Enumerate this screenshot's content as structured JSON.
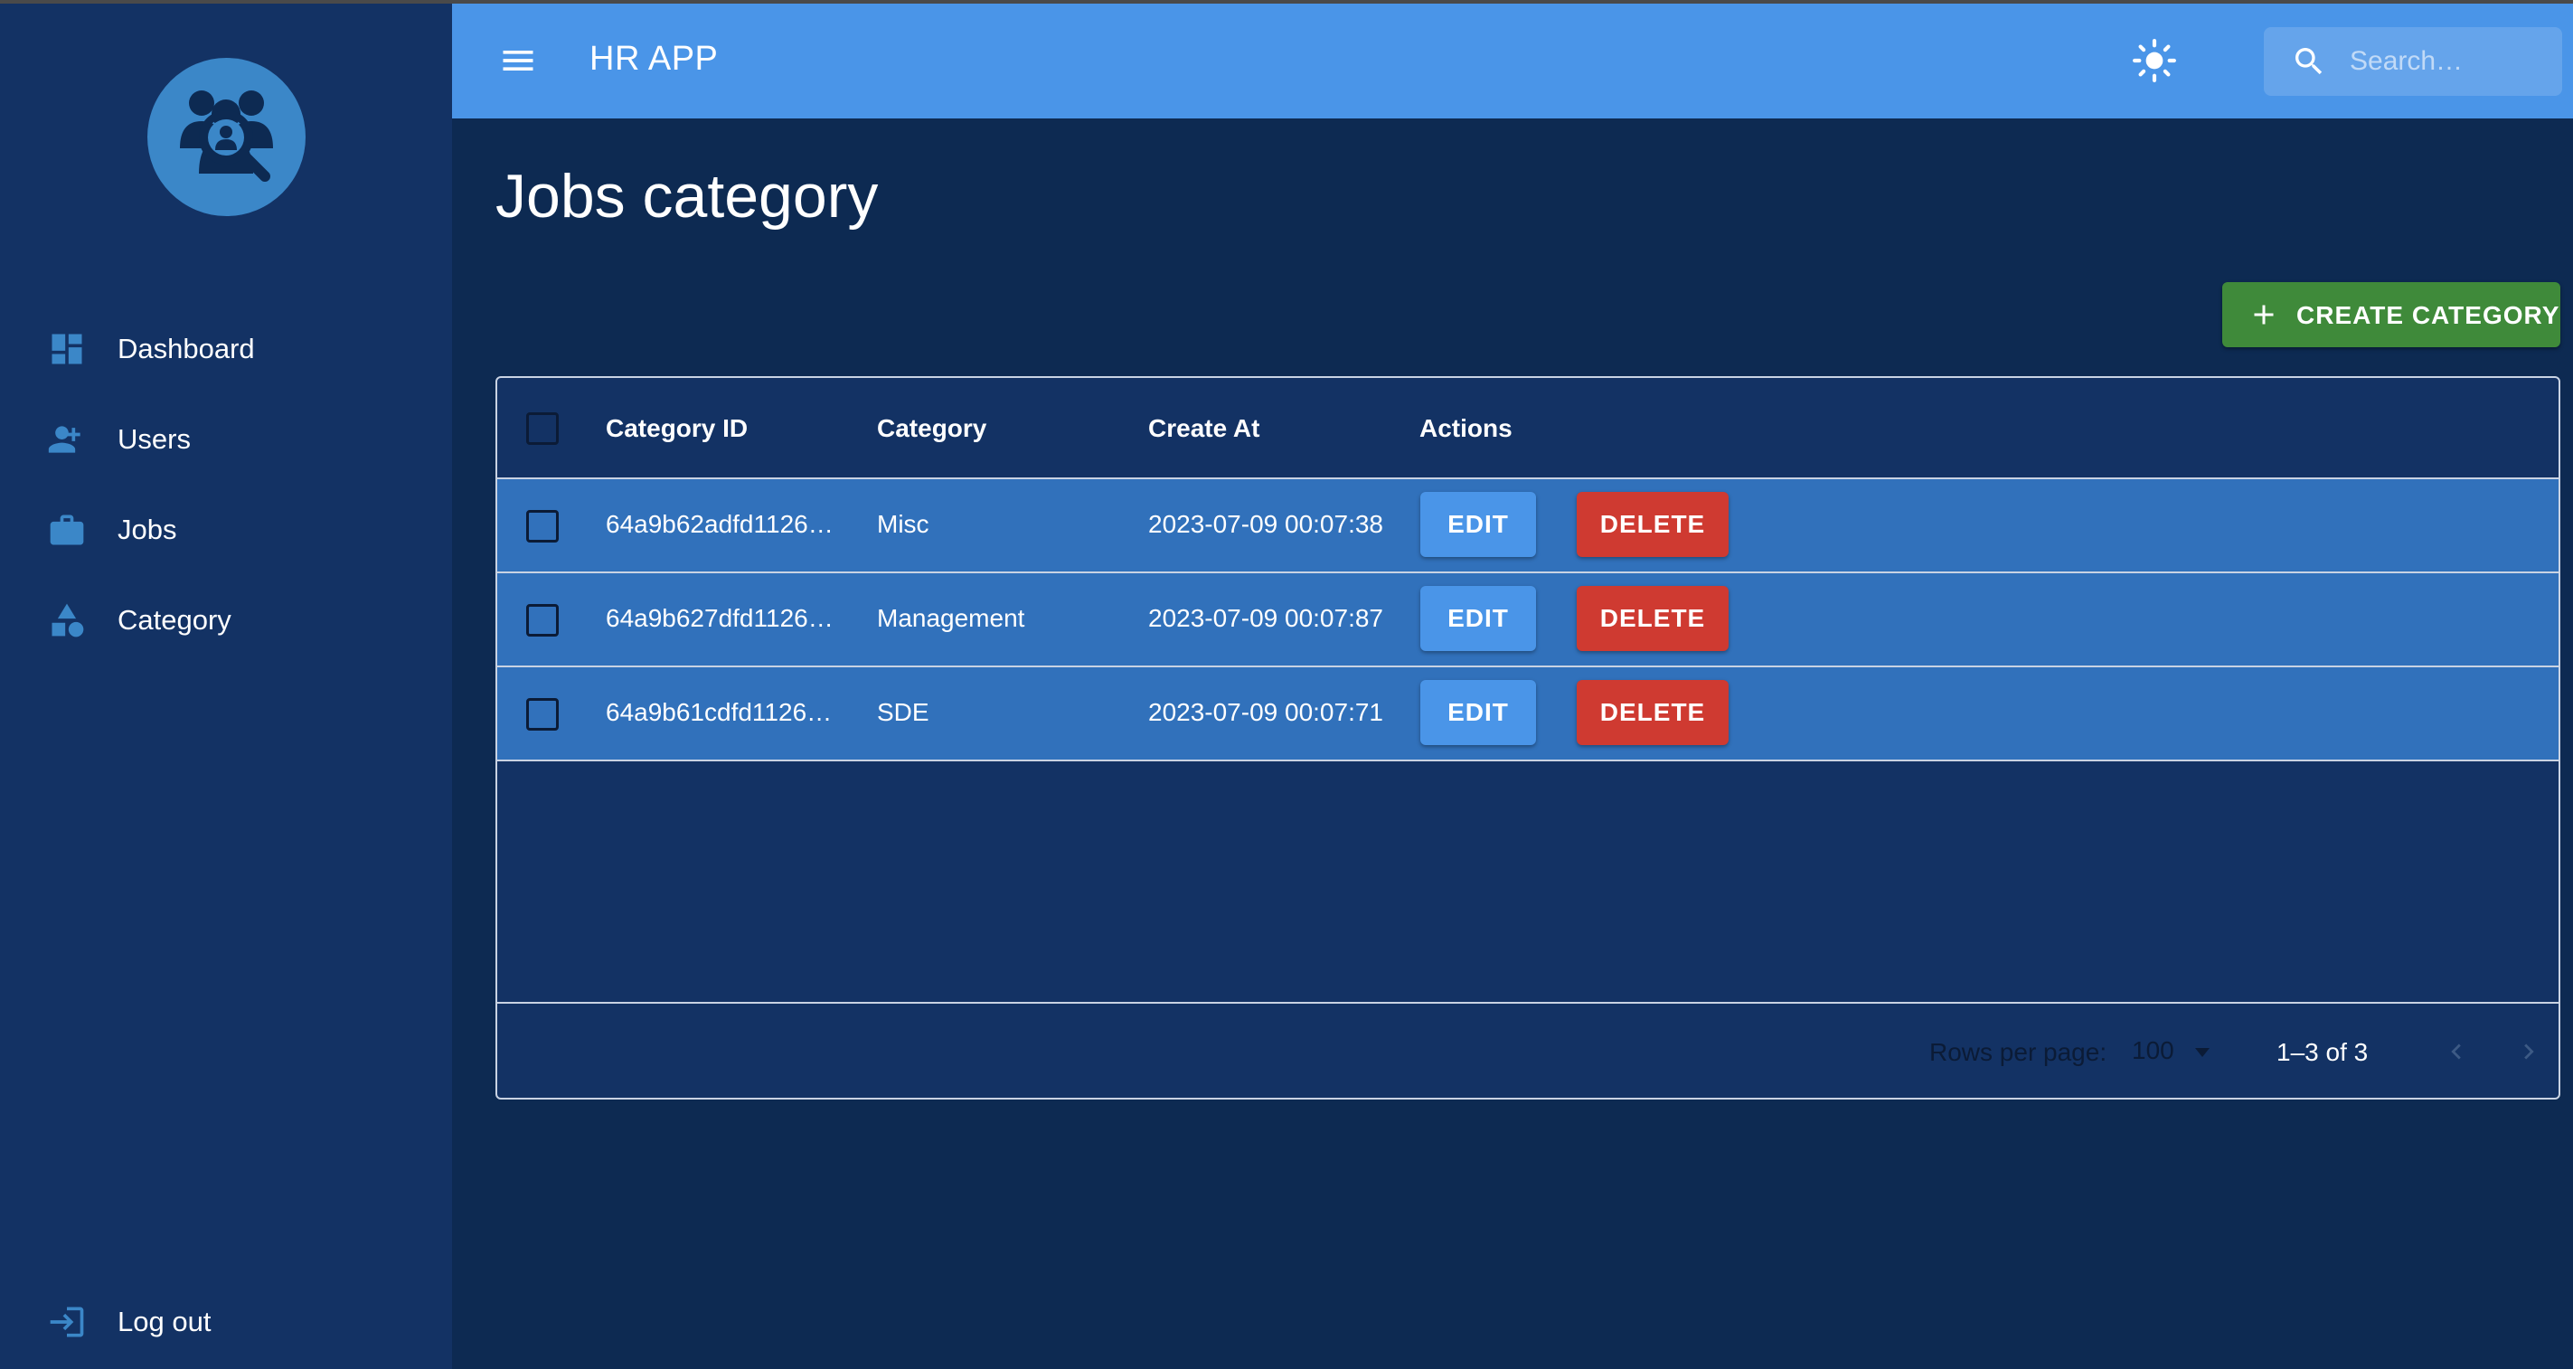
{
  "app": {
    "title": "HR APP"
  },
  "header": {
    "menu_icon": "menu-icon",
    "theme_icon": "sun-icon",
    "search": {
      "placeholder": "Search…",
      "value": ""
    }
  },
  "sidebar": {
    "logo_icon": "people-search-icon",
    "items": [
      {
        "label": "Dashboard",
        "icon": "dashboard-icon"
      },
      {
        "label": "Users",
        "icon": "add-user-icon"
      },
      {
        "label": "Jobs",
        "icon": "briefcase-icon"
      },
      {
        "label": "Category",
        "icon": "category-shapes-icon"
      }
    ],
    "logout": {
      "label": "Log out",
      "icon": "logout-icon"
    }
  },
  "main": {
    "title": "Jobs category",
    "create_button": {
      "label": "CREATE CATEGORY",
      "icon": "plus-icon"
    }
  },
  "table": {
    "columns": [
      "Category ID",
      "Category",
      "Create At",
      "Actions"
    ],
    "rows": [
      {
        "id": "64a9b62adfd1126…",
        "category": "Misc",
        "created": "2023-07-09 00:07:38"
      },
      {
        "id": "64a9b627dfd1126…",
        "category": "Management",
        "created": "2023-07-09 00:07:87"
      },
      {
        "id": "64a9b61cdfd1126…",
        "category": "SDE",
        "created": "2023-07-09 00:07:71"
      }
    ],
    "edit_label": "EDIT",
    "delete_label": "DELETE",
    "footer": {
      "rows_per_page_label": "Rows per page:",
      "rows_per_page_value": "100",
      "range": "1–3 of 3"
    }
  },
  "colors": {
    "sidebar_bg": "#133264",
    "header_bg": "#4a95e8",
    "main_bg": "#0d2a52",
    "row_bg": "#3171bb",
    "create_btn": "#3f8a3a",
    "delete_btn": "#cf3a31",
    "edit_btn": "#4a95e8"
  }
}
